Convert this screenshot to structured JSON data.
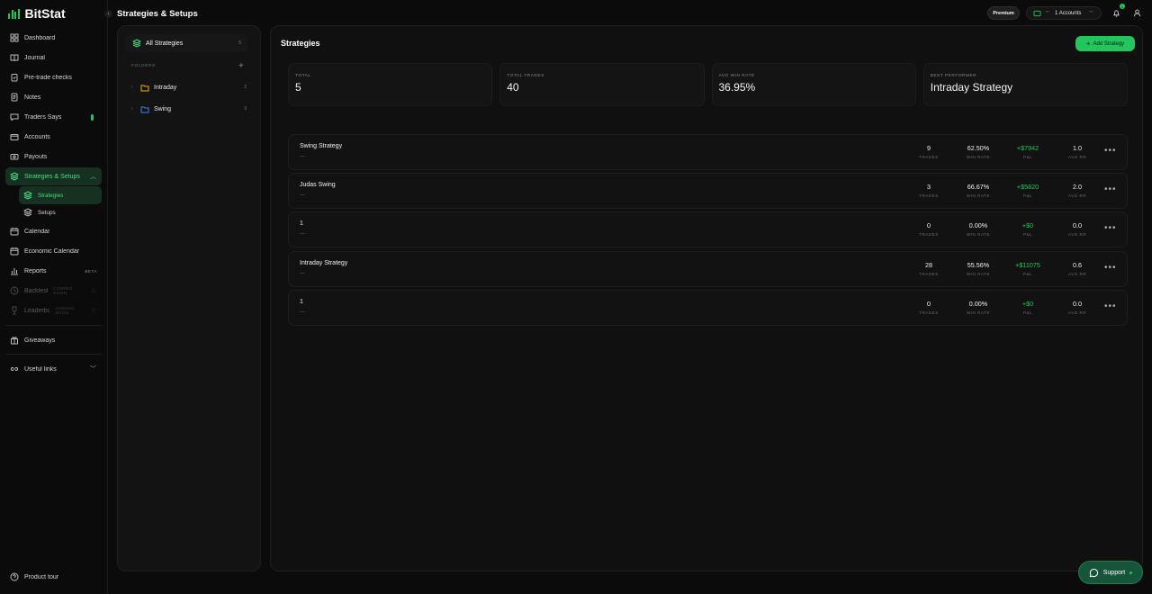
{
  "app": {
    "name": "BitStat"
  },
  "header": {
    "title": "Strategies & Setups",
    "premium_label": "Premium",
    "accounts_label": "1 Accounts",
    "notification_count": "1"
  },
  "sidebar": {
    "items": [
      {
        "label": "Dashboard"
      },
      {
        "label": "Journal"
      },
      {
        "label": "Pre-trade checks"
      },
      {
        "label": "Notes"
      },
      {
        "label": "Traders Says"
      },
      {
        "label": "Accounts"
      },
      {
        "label": "Payouts"
      },
      {
        "label": "Strategies & Setups"
      },
      {
        "label": "Strategies"
      },
      {
        "label": "Setups"
      },
      {
        "label": "Calendar"
      },
      {
        "label": "Economic Calendar"
      },
      {
        "label": "Reports",
        "badge": "BETA"
      },
      {
        "label": "Backtests",
        "badge": "COMING SOON"
      },
      {
        "label": "Leaderbo...",
        "badge": "COMING SOON"
      },
      {
        "label": "Giveaways"
      },
      {
        "label": "Useful links"
      }
    ],
    "product_tour": "Product tour"
  },
  "folders_panel": {
    "all_label": "All Strategies",
    "all_count": "5",
    "folders_label": "FOLDERS",
    "folders": [
      {
        "name": "Intraday",
        "count": "2",
        "color": "#eab308"
      },
      {
        "name": "Swing",
        "count": "3",
        "color": "#3b82f6"
      }
    ]
  },
  "main": {
    "title": "Strategies",
    "add_button": "Add Strategy",
    "stats": [
      {
        "label": "TOTAL",
        "value": "5"
      },
      {
        "label": "TOTAL TRADES",
        "value": "40"
      },
      {
        "label": "AVG WIN RATE",
        "value": "36.95%"
      },
      {
        "label": "BEST PERFORMER",
        "value": "Intraday Strategy"
      }
    ],
    "metric_labels": {
      "trades": "TRADES",
      "winrate": "WIN RATE",
      "pnl": "P&L",
      "rr": "AVG RR"
    },
    "strategies": [
      {
        "name": "Swing Strategy",
        "desc": "—",
        "trades": "9",
        "winrate": "62.50%",
        "pnl": "+$7942",
        "rr": "1.0"
      },
      {
        "name": "Judas Swing",
        "desc": "—",
        "trades": "3",
        "winrate": "66.67%",
        "pnl": "+$5820",
        "rr": "2.0"
      },
      {
        "name": "1",
        "desc": "—",
        "trades": "0",
        "winrate": "0.00%",
        "pnl": "+$0",
        "rr": "0.0"
      },
      {
        "name": "Intraday Strategy",
        "desc": "—",
        "trades": "28",
        "winrate": "55.56%",
        "pnl": "+$11075",
        "rr": "0.6"
      },
      {
        "name": "1",
        "desc": "—",
        "trades": "0",
        "winrate": "0.00%",
        "pnl": "+$0",
        "rr": "0.0"
      }
    ]
  },
  "support": {
    "label": "Support"
  },
  "colors": {
    "accent": "#22c55e",
    "bg": "#0b0b0b",
    "panel": "#131313"
  }
}
